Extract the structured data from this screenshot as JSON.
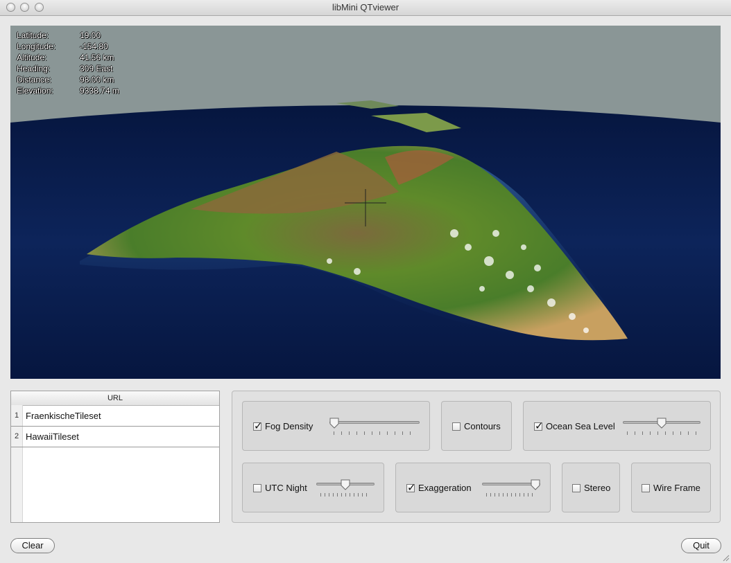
{
  "window": {
    "title": "libMini QTviewer"
  },
  "hud": {
    "rows": [
      {
        "label": "Latitude:",
        "value": "19.00"
      },
      {
        "label": "Longitude:",
        "value": "-154.80"
      },
      {
        "label": "Altitude:",
        "value": "41.56  km"
      },
      {
        "label": "Heading:",
        "value": "309    East"
      },
      {
        "label": "Distance:",
        "value": "98.00  km"
      },
      {
        "label": "Elevation:",
        "value": "9338.74 m"
      }
    ]
  },
  "url_table": {
    "header": "URL",
    "rows": [
      {
        "num": "1",
        "url": "FraenkischeTileset"
      },
      {
        "num": "2",
        "url": "HawaiiTileset"
      }
    ]
  },
  "controls": {
    "fog_density": {
      "label": "Fog Density",
      "checked": true,
      "level": 0.0
    },
    "contours": {
      "label": "Contours",
      "checked": false
    },
    "ocean_sea_level": {
      "label": "Ocean Sea Level",
      "checked": true,
      "level": 0.5
    },
    "utc_night": {
      "label": "UTC Night",
      "checked": false,
      "level": 0.5
    },
    "exaggeration": {
      "label": "Exaggeration",
      "checked": true,
      "level": 1.0
    },
    "stereo": {
      "label": "Stereo",
      "checked": false
    },
    "wire_frame": {
      "label": "Wire Frame",
      "checked": false
    }
  },
  "buttons": {
    "clear": "Clear",
    "quit": "Quit"
  },
  "colors": {
    "ocean": "#0c1f4f",
    "sky": "#8a9696"
  }
}
